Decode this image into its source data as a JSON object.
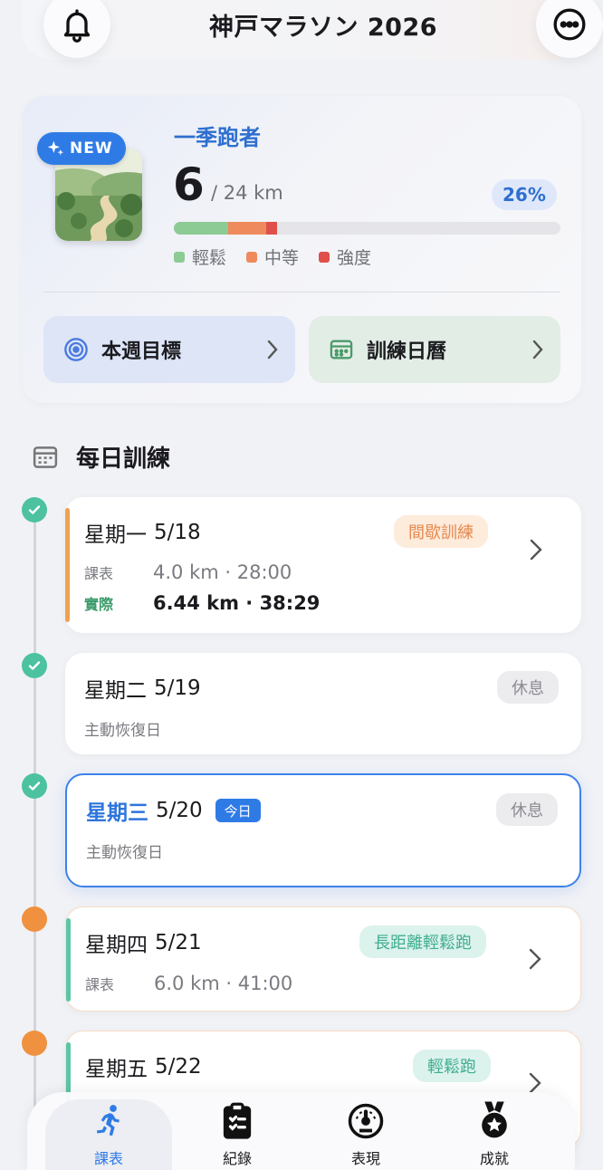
{
  "header": {
    "title": "神戸マラソン 2026"
  },
  "summary": {
    "badge": "NEW",
    "runner_level": "一季跑者",
    "km_done": "6",
    "km_total": "/ 24 km",
    "percent": "26%",
    "progress": {
      "easy": 0.14,
      "moderate": 0.1,
      "hard": 0.026
    },
    "legend": [
      {
        "label": "輕鬆",
        "color": "#8ccb94"
      },
      {
        "label": "中等",
        "color": "#ef8a5c"
      },
      {
        "label": "強度",
        "color": "#e0504a"
      }
    ],
    "actions": {
      "weekly_goal": "本週目標",
      "training_calendar": "訓練日曆"
    }
  },
  "daily": {
    "title": "每日訓練",
    "days": [
      {
        "name": "星期一",
        "date": "5/18",
        "tag": "間歇訓練",
        "plan_label": "課表",
        "plan_value": "4.0 km · 28:00",
        "actual_label": "實際",
        "actual_value": "6.44 km · 38:29"
      },
      {
        "name": "星期二",
        "date": "5/19",
        "tag": "休息",
        "note": "主動恢復日"
      },
      {
        "name": "星期三",
        "date": "5/20",
        "today": "今日",
        "tag": "休息",
        "note": "主動恢復日"
      },
      {
        "name": "星期四",
        "date": "5/21",
        "tag": "長距離輕鬆跑",
        "plan_label": "課表",
        "plan_value": "6.0 km · 41:00"
      },
      {
        "name": "星期五",
        "date": "5/22",
        "tag": "輕鬆跑"
      }
    ]
  },
  "nav": {
    "items": [
      {
        "label": "課表",
        "icon": "runner-icon"
      },
      {
        "label": "紀錄",
        "icon": "clipboard-icon"
      },
      {
        "label": "表現",
        "icon": "gauge-icon"
      },
      {
        "label": "成就",
        "icon": "medal-icon"
      }
    ]
  },
  "colors": {
    "accent": "#2f7be6",
    "done": "#4cc2a0",
    "pending": "#f0913f"
  }
}
